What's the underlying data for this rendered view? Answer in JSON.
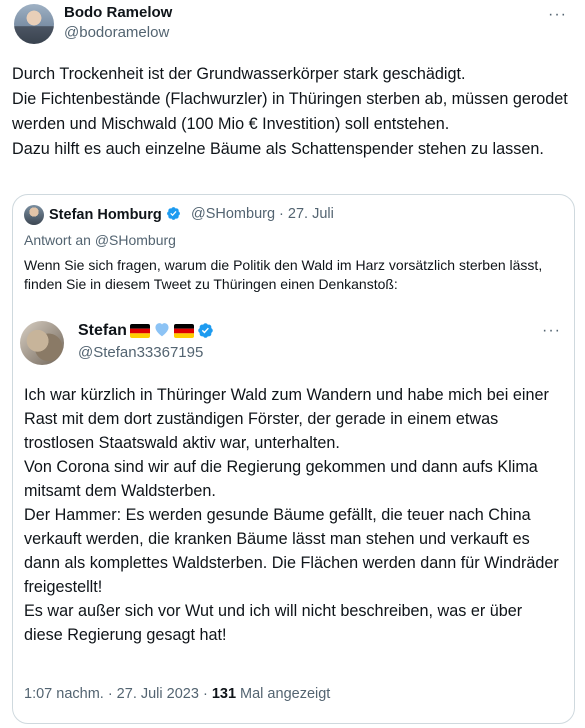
{
  "main_tweet": {
    "display_name": "Bodo Ramelow",
    "handle": "@bodoramelow",
    "more": "···",
    "text": "Durch Trockenheit ist der Grundwasserkörper stark geschädigt.\nDie Fichtenbestände (Flachwurzler) in Thüringen sterben ab, müssen gerodet werden und Mischwald (100 Mio € Investition) soll entstehen.\nDazu hilft es auch einzelne Bäume als Schattenspender stehen zu lassen."
  },
  "quoted_tweet": {
    "display_name": "Stefan Homburg",
    "handle_date": "@SHomburg · 27. Juli",
    "reply_to": "Antwort an @SHomburg",
    "text": "Wenn Sie sich fragen, warum die Politik den Wald im Harz vorsätzlich sterben lässt, finden Sie in diesem Tweet zu Thüringen einen Denkanstoß:",
    "verified_color": "#1d9bf0"
  },
  "nested_tweet": {
    "display_name": "Stefan",
    "handle": "@Stefan33367195",
    "more": "···",
    "emoji": [
      "german-flag-icon",
      "blue-heart-icon",
      "german-flag-icon"
    ],
    "text": "Ich war kürzlich in Thüringer Wald zum Wandern und habe mich bei einer Rast mit dem dort zuständigen Förster, der gerade in einem etwas trostlosen Staatswald aktiv war, unterhalten.\nVon Corona sind wir auf die Regierung gekommen und dann aufs Klima mitsamt dem Waldsterben.\nDer Hammer: Es werden gesunde Bäume gefällt, die teuer nach China verkauft werden, die kranken Bäume lässt man stehen und verkauft es dann als komplettes Waldsterben. Die Flächen werden dann für Windräder freigestellt!\nEs war außer sich vor Wut und ich will nicht beschreiben, was er über diese Regierung gesagt hat!",
    "timestamp": "1:07 nachm. · 27. Juli 2023 · ",
    "views_count": "131",
    "views_label": " Mal angezeigt"
  }
}
